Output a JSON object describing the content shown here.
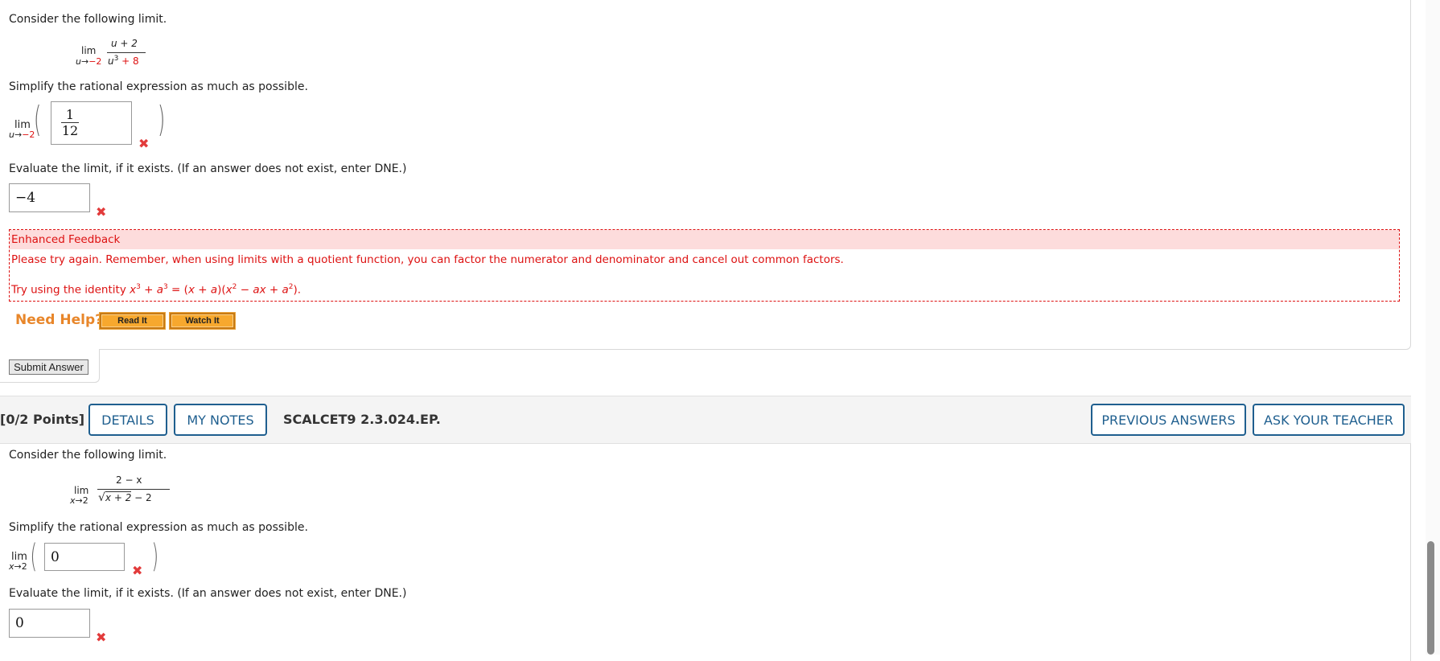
{
  "q1": {
    "intro": "Consider the following limit.",
    "limit": {
      "lim": "lim",
      "var": "u",
      "arrow": "→",
      "approach": "−2",
      "num": "u + 2",
      "den_base": "u",
      "den_exp": "3",
      "den_rest": " + 8"
    },
    "simplify_prompt": "Simplify the rational expression as much as possible.",
    "simplify_lim": {
      "lim": "lim",
      "var": "u",
      "arrow": "→",
      "approach": "−2"
    },
    "simplify_answer": {
      "num": "1",
      "den": "12"
    },
    "evaluate_prompt": "Evaluate the limit, if it exists. (If an answer does not exist, enter DNE.)",
    "evaluate_answer": "−4",
    "feedback": {
      "title": "Enhanced Feedback",
      "line1": "Please try again. Remember, when using limits with a quotient function, you can factor the numerator and denominator and cancel out common factors.",
      "line2_prefix": "Try using the identity ",
      "line2_math": {
        "x": "x",
        "e1": "3",
        "plus": " + ",
        "a": "a",
        "e2": "3",
        "eq": " = (",
        "x2": "x",
        "pa": " + ",
        "a2": "a",
        "mid": ")(",
        "x3": "x",
        "e3": "2",
        "minus": " − ",
        "ax": "ax",
        "plus2": " + ",
        "a3": "a",
        "e4": "2",
        "end": ")."
      }
    },
    "need_help": "Need Help?",
    "read_it": "Read It",
    "watch_it": "Watch It",
    "submit": "Submit Answer"
  },
  "q2": {
    "points": "[0/2 Points]",
    "details": "DETAILS",
    "my_notes": "MY NOTES",
    "question_id": "SCALCET9 2.3.024.EP.",
    "previous_answers": "PREVIOUS ANSWERS",
    "ask_teacher": "ASK YOUR TEACHER",
    "intro": "Consider the following limit.",
    "limit": {
      "lim": "lim",
      "var": "x",
      "arrow": "→",
      "approach": "2",
      "num": "2 − x",
      "radical": "√",
      "rad_in": "x + 2",
      "den_rest": " − 2"
    },
    "simplify_prompt": "Simplify the rational expression as much as possible.",
    "simplify_lim": {
      "lim": "lim",
      "var": "x",
      "arrow": "→",
      "approach": "2"
    },
    "simplify_answer": "0",
    "evaluate_prompt": "Evaluate the limit, if it exists. (If an answer does not exist, enter DNE.)",
    "evaluate_answer": "0"
  },
  "icons": {
    "wrong": "✖"
  },
  "colors": {
    "error": "#dd1111",
    "link_blue": "#1f5f8f",
    "help_orange": "#e8862a",
    "feedback_bg": "#fddcdc"
  }
}
